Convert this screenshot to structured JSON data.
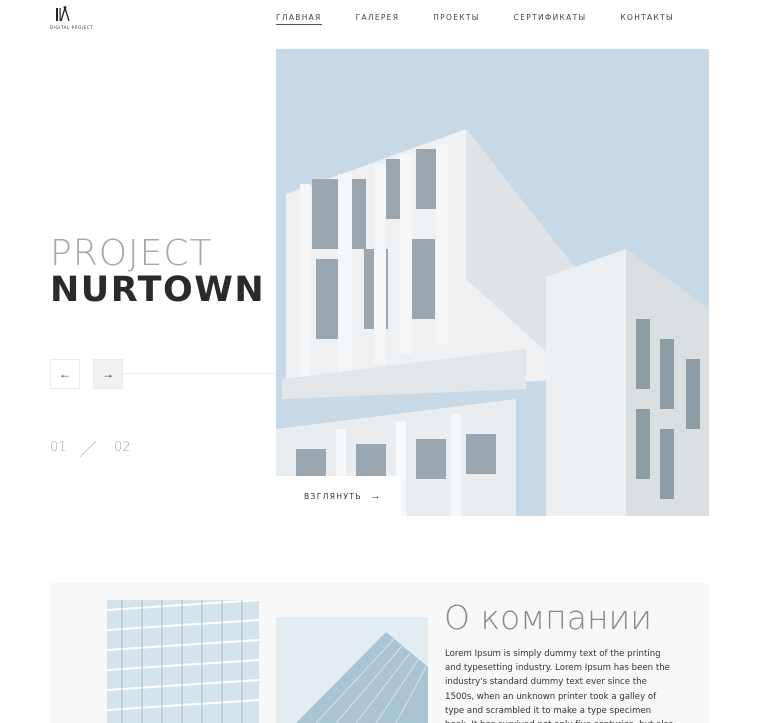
{
  "brand": {
    "logo_text": "DIGITAL PROJECT"
  },
  "nav": {
    "items": [
      {
        "label": "ГЛАВНАЯ",
        "active": true
      },
      {
        "label": "ГАЛЕРЕЯ",
        "active": false
      },
      {
        "label": "ПРОЕКТЫ",
        "active": false
      },
      {
        "label": "СЕРТИФИКАТЫ",
        "active": false
      },
      {
        "label": "КОНТАКТЫ",
        "active": false
      }
    ]
  },
  "hero": {
    "title_light": "PROJECT",
    "title_bold": "NURTOWN",
    "prev_icon": "←",
    "next_icon": "→",
    "slide_current": "01",
    "slide_total": "02",
    "look_label": "ВЗГЛЯНУТЬ",
    "look_icon": "→"
  },
  "about": {
    "title": "О компании",
    "text": "Lorem Ipsum is simply dummy text of the printing and typesetting industry. Lorem Ipsum has been the industry's standard dummy text ever since the 1500s, when an unknown printer took a galley of type and scrambled it to make a type specimen book. It has survived not only five centuries, but also the leap into"
  },
  "icons": {
    "logo": "logo-icon",
    "prev": "arrow-left-icon",
    "next": "arrow-right-icon",
    "look": "arrow-right-icon"
  },
  "colors": {
    "sky": "#c7d9e6",
    "title_light": "#a7a7a7",
    "title_bold": "#2a2a2a",
    "section_bg": "#f8f8f8"
  }
}
